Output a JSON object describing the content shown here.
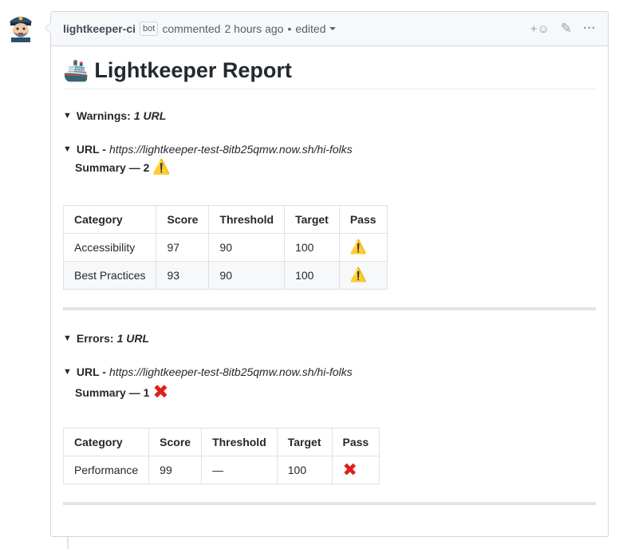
{
  "comment": {
    "author": "lightkeeper-ci",
    "badge": "bot",
    "action": "commented",
    "time": "2 hours ago",
    "separator": "•",
    "edited": "edited",
    "reaction_icon": "+☺",
    "edit_icon": "✎",
    "more_icon": "···"
  },
  "report": {
    "ship_icon": "🚢",
    "title": "Lightkeeper Report"
  },
  "warnings": {
    "label": "Warnings:",
    "count": "1 URL",
    "url_prefix": "URL -",
    "url": "https://lightkeeper-test-8itb25qmw.now.sh/hi-folks",
    "summary": "Summary — 2",
    "summary_icon": "⚠️",
    "table": {
      "headers": [
        "Category",
        "Score",
        "Threshold",
        "Target",
        "Pass"
      ],
      "rows": [
        [
          "Accessibility",
          "97",
          "90",
          "100",
          "⚠️"
        ],
        [
          "Best Practices",
          "93",
          "90",
          "100",
          "⚠️"
        ]
      ]
    }
  },
  "errors": {
    "label": "Errors:",
    "count": "1 URL",
    "url_prefix": "URL -",
    "url": "https://lightkeeper-test-8itb25qmw.now.sh/hi-folks",
    "summary": "Summary — 1",
    "summary_icon": "✖",
    "table": {
      "headers": [
        "Category",
        "Score",
        "Threshold",
        "Target",
        "Pass"
      ],
      "rows": [
        [
          "Performance",
          "99",
          "—",
          "100",
          "✖"
        ]
      ]
    }
  },
  "colors": {
    "border": "#d1d5da",
    "header_bg": "#f6f8fa",
    "error_red": "#e0201a"
  }
}
